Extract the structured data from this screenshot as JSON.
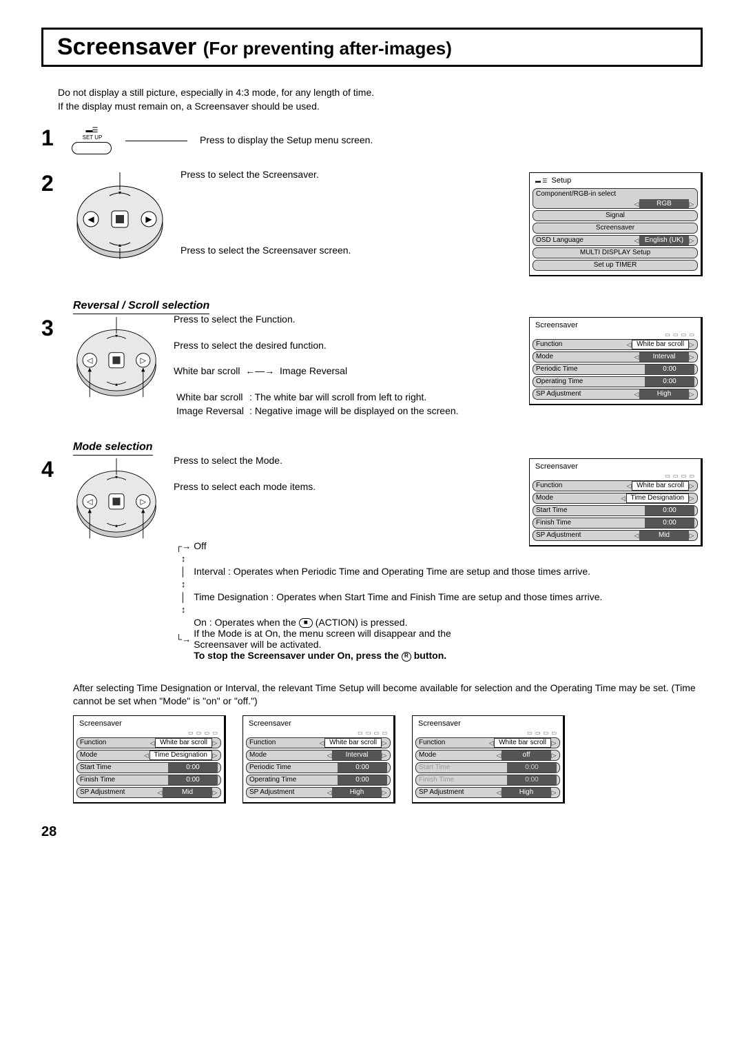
{
  "title_main": "Screensaver",
  "title_sub": "(For preventing after-images)",
  "intro_l1": "Do not display a still picture, especially in 4:3 mode, for any length of time.",
  "intro_l2": "If the display must remain on, a Screensaver should be used.",
  "step1": {
    "num": "1",
    "btn_label": "SET UP",
    "text": "Press to display the Setup menu screen."
  },
  "step2": {
    "num": "2",
    "text_top": "Press to select the Screensaver.",
    "text_bottom": "Press to select the Screensaver screen."
  },
  "setup_panel": {
    "title": "Setup",
    "row1_label": "Component/RGB-in  select",
    "row1_value": "RGB",
    "row2": "Signal",
    "row3": "Screensaver",
    "row4_label": "OSD  Language",
    "row4_value": "English (UK)",
    "row5": "MULTI DISPLAY Setup",
    "row6": "Set up TIMER"
  },
  "section_a": "Reversal / Scroll selection",
  "step3": {
    "num": "3",
    "t1": "Press to select the Function.",
    "t2": "Press to select the desired function.",
    "opt_l": "White bar scroll",
    "opt_r": "Image Reversal",
    "def1_l": "White bar scroll",
    "def1_r": ": The white bar will scroll from left to right.",
    "def2_l": "Image Reversal",
    "def2_r": ": Negative image will be displayed on the screen."
  },
  "ss_panel_a": {
    "title": "Screensaver",
    "r1_l": "Function",
    "r1_v": "White bar scroll",
    "r2_l": "Mode",
    "r2_v": "Interval",
    "r3_l": "Periodic Time",
    "r3_v": "0:00",
    "r4_l": "Operating Time",
    "r4_v": "0:00",
    "r5_l": "SP Adjustment",
    "r5_v": "High"
  },
  "section_b": "Mode selection",
  "step4": {
    "num": "4",
    "t1": "Press to select the Mode.",
    "t2": "Press to select each mode items.",
    "m_off": "Off",
    "m_interval": "Interval : Operates when Periodic Time and Operating Time are setup and those times arrive.",
    "m_timedes": "Time Designation : Operates when Start Time and Finish Time are setup and those times arrive.",
    "m_on_a": "On : Operates when the ",
    "m_on_b": " (ACTION) is pressed.",
    "m_on_note1": "If the Mode is at On, the menu screen will disappear and the",
    "m_on_note2": "Screensaver will be activated.",
    "stop_a": "To stop the Screensaver under On, press the ",
    "stop_b": " button."
  },
  "ss_panel_b": {
    "title": "Screensaver",
    "r1_l": "Function",
    "r1_v": "White bar scroll",
    "r2_l": "Mode",
    "r2_v": "Time Designation",
    "r3_l": "Start Time",
    "r3_v": "0:00",
    "r4_l": "Finish Time",
    "r4_v": "0:00",
    "r5_l": "SP Adjustment",
    "r5_v": "Mid"
  },
  "after_para": "After selecting Time Designation or Interval, the relevant Time Setup will become available for selection and the Operating Time may be set. (Time cannot be set when \"Mode\" is \"on\" or \"off.\")",
  "bottom_panels": {
    "p1": {
      "title": "Screensaver",
      "r1_l": "Function",
      "r1_v": "White bar scroll",
      "r2_l": "Mode",
      "r2_v": "Time Designation",
      "r3_l": "Start Time",
      "r3_v": "0:00",
      "r4_l": "Finish Time",
      "r4_v": "0:00",
      "r5_l": "SP Adjustment",
      "r5_v": "Mid"
    },
    "p2": {
      "title": "Screensaver",
      "r1_l": "Function",
      "r1_v": "White bar scroll",
      "r2_l": "Mode",
      "r2_v": "Interval",
      "r3_l": "Periodic Time",
      "r3_v": "0:00",
      "r4_l": "Operating Time",
      "r4_v": "0:00",
      "r5_l": "SP Adjustment",
      "r5_v": "High"
    },
    "p3": {
      "title": "Screensaver",
      "r1_l": "Function",
      "r1_v": "White bar scroll",
      "r2_l": "Mode",
      "r2_v": "off",
      "r3_l": "Start Time",
      "r3_v": "0:00",
      "r4_l": "Finish Time",
      "r4_v": "0:00",
      "r5_l": "SP Adjustment",
      "r5_v": "High"
    }
  },
  "page_number": "28",
  "action_icon_label": "■",
  "return_icon_label": "R"
}
